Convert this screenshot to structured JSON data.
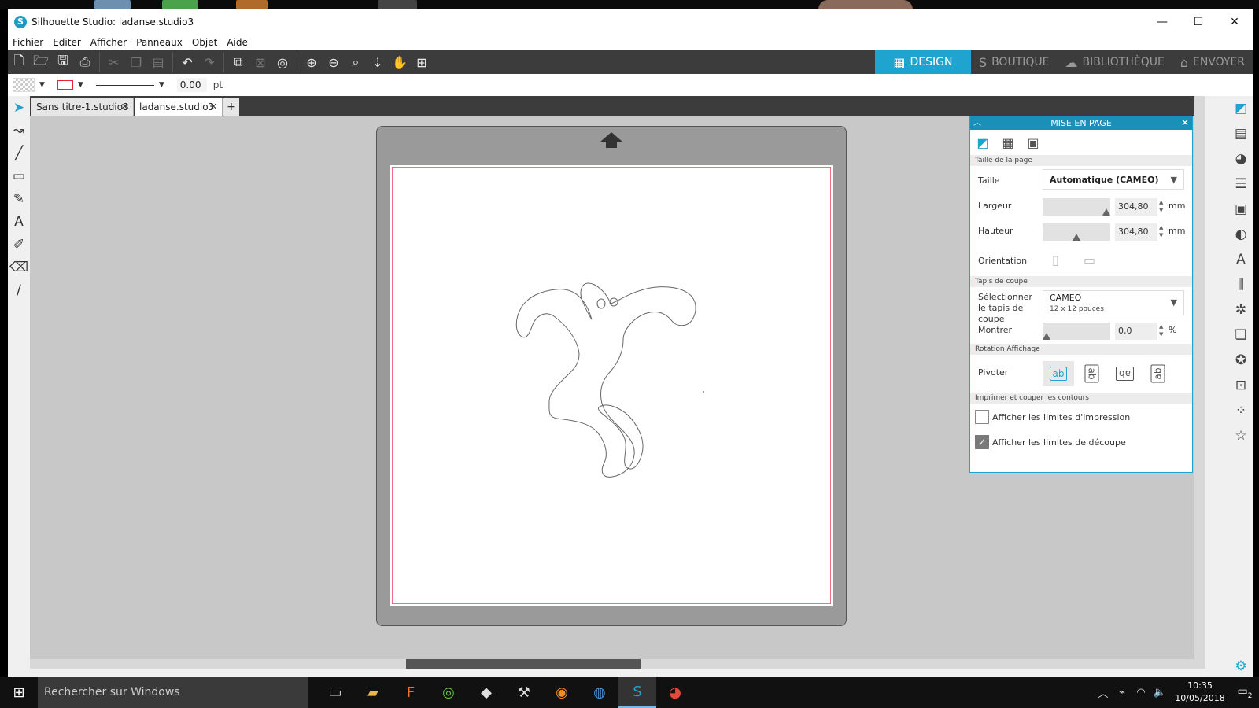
{
  "window": {
    "title": "Silhouette Studio: ladanse.studio3",
    "app_logo": "S"
  },
  "window_controls": {
    "minimize": "—",
    "maximize": "☐",
    "close": "✕"
  },
  "menu": [
    "Fichier",
    "Editer",
    "Afficher",
    "Panneaux",
    "Objet",
    "Aide"
  ],
  "nav_tabs": [
    {
      "label": "DESIGN",
      "icon": "grid-icon",
      "glyph": "▦"
    },
    {
      "label": "BOUTIQUE",
      "icon": "s-logo-icon",
      "glyph": "S"
    },
    {
      "label": "BIBLIOTHÈQUE",
      "icon": "cloud-icon",
      "glyph": "☁"
    },
    {
      "label": "ENVOYER",
      "icon": "cutter-icon",
      "glyph": "⌂"
    }
  ],
  "propbar": {
    "line_width": "0.00",
    "unit": "pt",
    "line_color": "#e02030"
  },
  "doc_tabs": [
    {
      "label": "Sans titre-1.studio3",
      "close": "✕"
    },
    {
      "label": "ladanse.studio3",
      "close": "✕"
    }
  ],
  "add_tab": "+",
  "panel": {
    "title": "MISE EN PAGE",
    "sections": {
      "page_size": "Taille de la page",
      "cut_mat": "Tapis de coupe",
      "rotation": "Rotation Affichage",
      "print_cut": "Imprimer et couper les contours"
    },
    "taille_label": "Taille",
    "taille_value": "Automatique (CAMEO)",
    "largeur_label": "Largeur",
    "largeur_value": "304,80",
    "hauteur_label": "Hauteur",
    "hauteur_value": "304,80",
    "unit_mm": "mm",
    "orientation_label": "Orientation",
    "select_mat_label": "Sélectionner le tapis de coupe",
    "mat_value": "CAMEO",
    "mat_sub": "12 x 12 pouces",
    "montrer_label": "Montrer",
    "montrer_value": "0,0",
    "unit_pct": "%",
    "pivoter_label": "Pivoter",
    "rotation_options": [
      "ab",
      "ab",
      "ab",
      "ab"
    ],
    "checkbox_print": "Afficher les limites d'impression",
    "checkbox_cut": "Afficher les limites de découpe",
    "checkbox_print_checked": false,
    "checkbox_cut_checked": true
  },
  "taskbar": {
    "search_placeholder": "Rechercher sur Windows",
    "time": "10:35",
    "date": "10/05/2018",
    "notifications": "2"
  }
}
